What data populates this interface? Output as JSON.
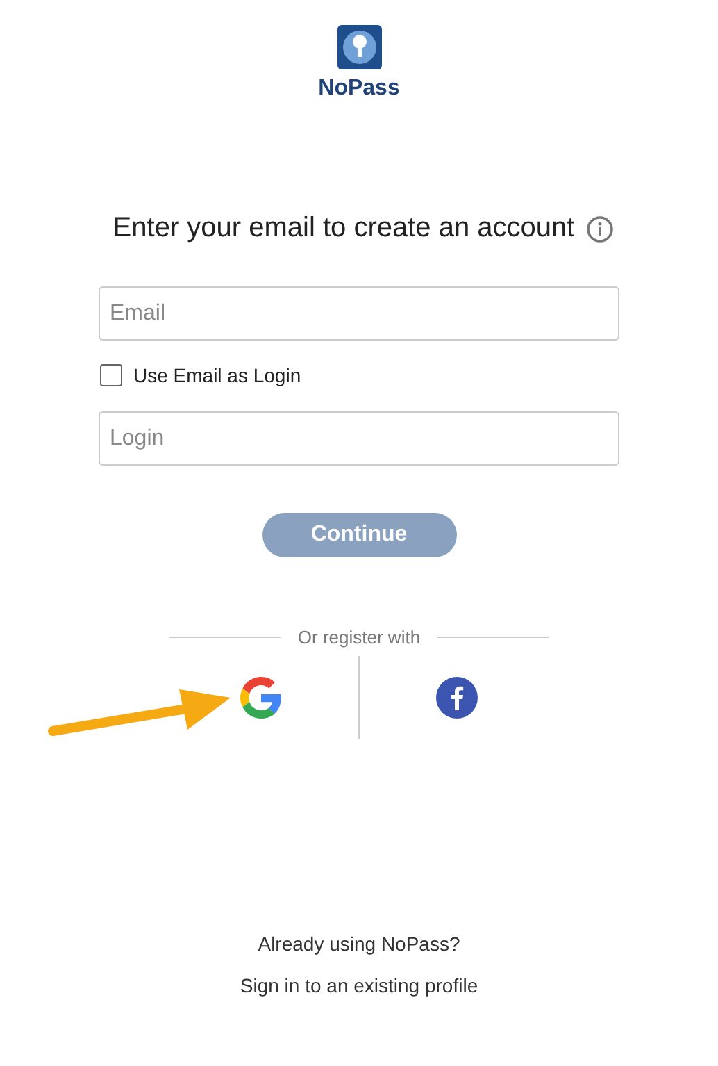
{
  "brand": {
    "name": "NoPass"
  },
  "heading": "Enter your email to create an account",
  "email_field": {
    "placeholder": "Email"
  },
  "use_email_as_login": {
    "label": "Use Email as Login",
    "checked": false
  },
  "login_field": {
    "placeholder": "Login"
  },
  "continue_button": {
    "label": "Continue",
    "disabled": true
  },
  "divider_text": "Or register with",
  "social": [
    {
      "kind": "google"
    },
    {
      "kind": "facebook"
    }
  ],
  "footer": {
    "question": "Already using NoPass?",
    "link": "Sign in to an existing profile"
  }
}
